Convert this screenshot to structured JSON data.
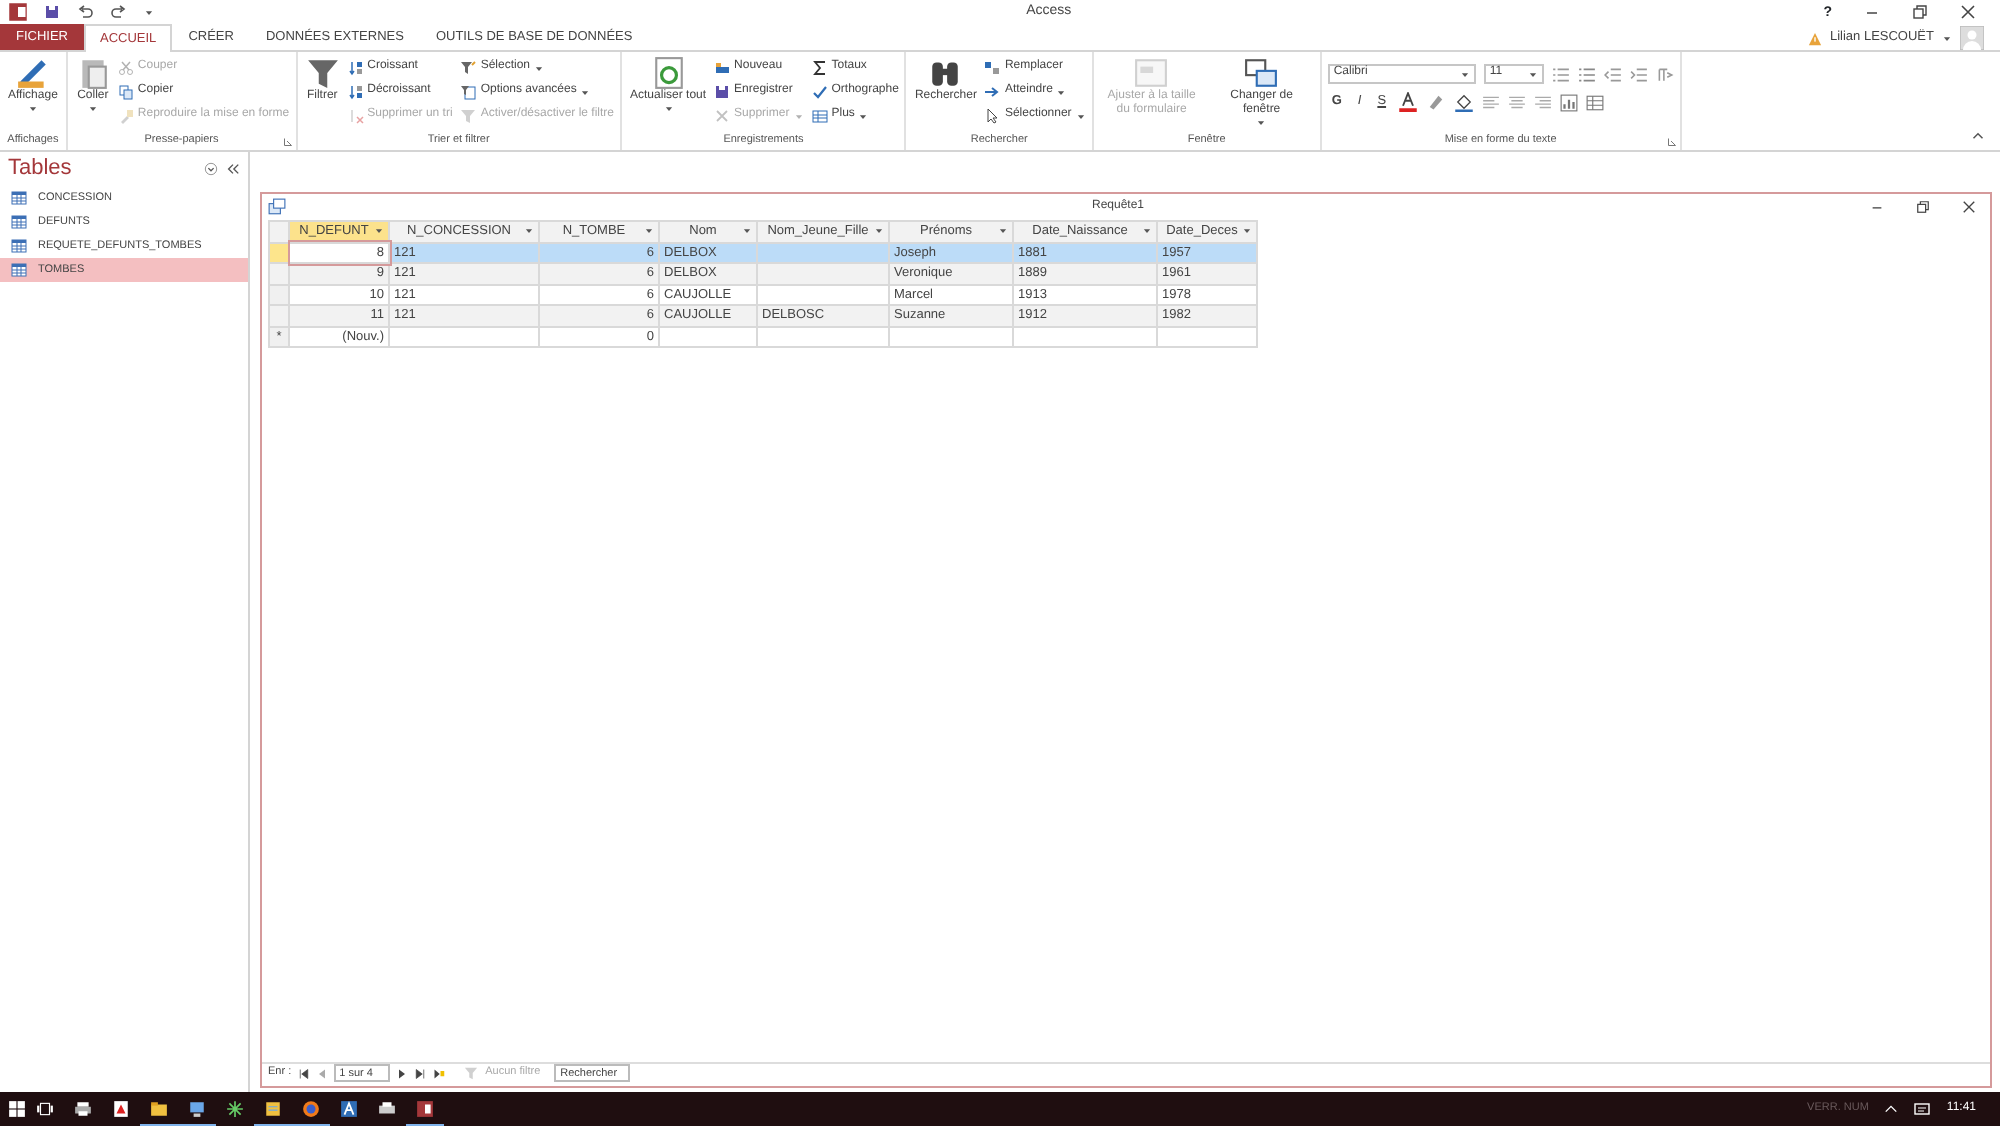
{
  "app": {
    "title": "Access",
    "help": "?"
  },
  "ribbon_tabs": [
    {
      "label": "FICHIER",
      "kind": "file",
      "selected": false
    },
    {
      "label": "ACCUEIL",
      "kind": "tab",
      "selected": true
    },
    {
      "label": "CRÉER",
      "kind": "tab",
      "selected": false
    },
    {
      "label": "DONNÉES EXTERNES",
      "kind": "tab",
      "selected": false
    },
    {
      "label": "OUTILS DE BASE DE DONNÉES",
      "kind": "tab",
      "selected": false
    }
  ],
  "user": {
    "name": "Lilian LESCOUËT"
  },
  "ribbon_groups": [
    {
      "label": "Affichages",
      "kind": "commands",
      "launcher": false,
      "commands": [
        {
          "label": "Affichage",
          "kind": "large",
          "disabled": false,
          "dropdown": true
        }
      ]
    },
    {
      "label": "Presse-papiers",
      "kind": "commands",
      "launcher": true,
      "commands": [
        {
          "label": "Coller",
          "kind": "large",
          "disabled": false,
          "dropdown": true
        },
        {
          "label": "Couper",
          "kind": "small",
          "disabled": true,
          "dropdown": false
        },
        {
          "label": "Copier",
          "kind": "small",
          "disabled": false,
          "dropdown": false
        },
        {
          "label": "Reproduire la mise en forme",
          "kind": "small",
          "disabled": true,
          "dropdown": false
        }
      ]
    },
    {
      "label": "Trier et filtrer",
      "kind": "commands",
      "launcher": false,
      "commands": [
        {
          "label": "Filtrer",
          "kind": "large",
          "disabled": false,
          "dropdown": false
        },
        {
          "label": "Croissant",
          "kind": "small",
          "disabled": false,
          "dropdown": false
        },
        {
          "label": "Décroissant",
          "kind": "small",
          "disabled": false,
          "dropdown": false
        },
        {
          "label": "Supprimer un tri",
          "kind": "small",
          "disabled": true,
          "dropdown": false
        },
        {
          "label": "Sélection",
          "kind": "small",
          "disabled": false,
          "dropdown": true
        },
        {
          "label": "Options avancées",
          "kind": "small",
          "disabled": false,
          "dropdown": true
        },
        {
          "label": "Activer/désactiver le filtre",
          "kind": "small",
          "disabled": true,
          "dropdown": false
        }
      ]
    },
    {
      "label": "Enregistrements",
      "kind": "commands",
      "launcher": false,
      "commands": [
        {
          "label": "Actualiser tout",
          "kind": "large",
          "disabled": false,
          "dropdown": true
        },
        {
          "label": "Nouveau",
          "kind": "small",
          "disabled": false,
          "dropdown": false
        },
        {
          "label": "Enregistrer",
          "kind": "small",
          "disabled": false,
          "dropdown": false
        },
        {
          "label": "Supprimer",
          "kind": "small",
          "disabled": true,
          "dropdown": true
        },
        {
          "label": "Totaux",
          "kind": "small",
          "disabled": false,
          "dropdown": false
        },
        {
          "label": "Orthographe",
          "kind": "small",
          "disabled": false,
          "dropdown": false
        },
        {
          "label": "Plus",
          "kind": "small",
          "disabled": false,
          "dropdown": true
        }
      ]
    },
    {
      "label": "Rechercher",
      "kind": "commands",
      "launcher": false,
      "commands": [
        {
          "label": "Rechercher",
          "kind": "large",
          "disabled": false,
          "dropdown": false
        },
        {
          "label": "Remplacer",
          "kind": "small",
          "disabled": false,
          "dropdown": false
        },
        {
          "label": "Atteindre",
          "kind": "small",
          "disabled": false,
          "dropdown": true
        },
        {
          "label": "Sélectionner",
          "kind": "small",
          "disabled": false,
          "dropdown": true
        }
      ]
    },
    {
      "label": "Fenêtre",
      "kind": "commands",
      "launcher": false,
      "commands": [
        {
          "label": "Ajuster à la taille du formulaire",
          "kind": "large",
          "disabled": true,
          "dropdown": false
        },
        {
          "label": "Changer de fenêtre",
          "kind": "large",
          "disabled": false,
          "dropdown": true
        }
      ]
    },
    {
      "label": "Mise en forme du texte",
      "kind": "format",
      "launcher": true,
      "font": "Calibri",
      "size": "11",
      "styles": [
        "G",
        "I",
        "S"
      ]
    }
  ],
  "nav_pane": {
    "title": "Tables",
    "items": [
      {
        "label": "CONCESSION",
        "selected": false
      },
      {
        "label": "DEFUNTS",
        "selected": false
      },
      {
        "label": "REQUETE_DEFUNTS_TOMBES",
        "selected": false
      },
      {
        "label": "TOMBES",
        "selected": true
      }
    ]
  },
  "query_window": {
    "title": "Requête1",
    "columns": [
      {
        "label": "N_DEFUNT",
        "kind": "number",
        "selected": true
      },
      {
        "label": "N_CONCESSION",
        "kind": "text",
        "selected": false
      },
      {
        "label": "N_TOMBE",
        "kind": "number",
        "selected": false
      },
      {
        "label": "Nom",
        "kind": "text",
        "selected": false
      },
      {
        "label": "Nom_Jeune_Fille",
        "kind": "text",
        "selected": false
      },
      {
        "label": "Prénoms",
        "kind": "text",
        "selected": false
      },
      {
        "label": "Date_Naissance",
        "kind": "text",
        "selected": false
      },
      {
        "label": "Date_Deces",
        "kind": "text",
        "selected": false
      }
    ],
    "rows": [
      {
        "kind": "record",
        "selected": true,
        "cells": [
          "8",
          "121",
          "6",
          "DELBOX",
          "",
          "Joseph",
          "1881",
          "1957"
        ]
      },
      {
        "kind": "record",
        "selected": false,
        "cells": [
          "9",
          "121",
          "6",
          "DELBOX",
          "",
          "Veronique",
          "1889",
          "1961"
        ]
      },
      {
        "kind": "record",
        "selected": false,
        "cells": [
          "10",
          "121",
          "6",
          "CAUJOLLE",
          "",
          "Marcel",
          "1913",
          "1978"
        ]
      },
      {
        "kind": "record",
        "selected": false,
        "cells": [
          "11",
          "121",
          "6",
          "CAUJOLLE",
          "DELBOSC",
          "Suzanne",
          "1912",
          "1982"
        ]
      },
      {
        "kind": "new",
        "selected": false,
        "marker": "*",
        "cells": [
          "(Nouv.)",
          "",
          "0",
          "",
          "",
          "",
          "",
          ""
        ]
      }
    ],
    "record_nav": {
      "label": "Enr :",
      "position": "1 sur 4",
      "filter": "Aucun filtre",
      "filter_disabled": true,
      "search_placeholder": "Rechercher"
    }
  },
  "taskbar": {
    "status": "VERR. NUM",
    "clock": "11:41"
  }
}
